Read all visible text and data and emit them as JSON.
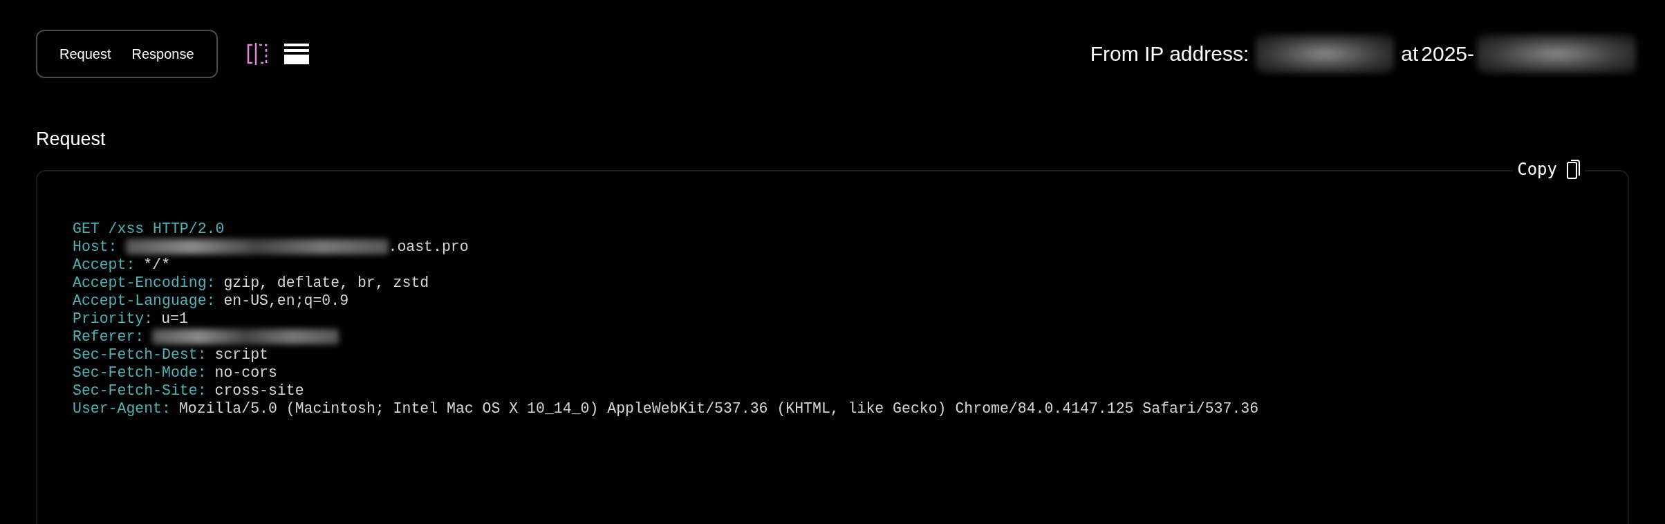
{
  "view_toggle": {
    "tabs": [
      "Request",
      "Response"
    ]
  },
  "source": {
    "ip_label": "From IP address:",
    "at_label": "at",
    "date_prefix": "2025-",
    "ip_redacted": true,
    "date_redacted": true
  },
  "request": {
    "title": "Request",
    "copy_label": "Copy",
    "first_line": "GET /xss HTTP/2.0",
    "headers": [
      {
        "name": "Host:",
        "redacted": true,
        "value": ".oast.pro"
      },
      {
        "name": "Accept:",
        "redacted": false,
        "value": "*/*"
      },
      {
        "name": "Accept-Encoding:",
        "redacted": false,
        "value": "gzip, deflate, br, zstd"
      },
      {
        "name": "Accept-Language:",
        "redacted": false,
        "value": "en-US,en;q=0.9"
      },
      {
        "name": "Priority:",
        "redacted": false,
        "value": "u=1"
      },
      {
        "name": "Referer:",
        "redacted": true
      },
      {
        "name": "Sec-Fetch-Dest:",
        "redacted": false,
        "value": "script"
      },
      {
        "name": "Sec-Fetch-Mode:",
        "redacted": false,
        "value": "no-cors"
      },
      {
        "name": "Sec-Fetch-Site:",
        "redacted": false,
        "value": "cross-site"
      },
      {
        "name": "User-Agent:",
        "redacted": false,
        "value": "Mozilla/5.0 (Macintosh; Intel Mac OS X 10_14_0) AppleWebKit/537.36 (KHTML, like Gecko) Chrome/84.0.4147.125 Safari/537.36"
      }
    ]
  }
}
